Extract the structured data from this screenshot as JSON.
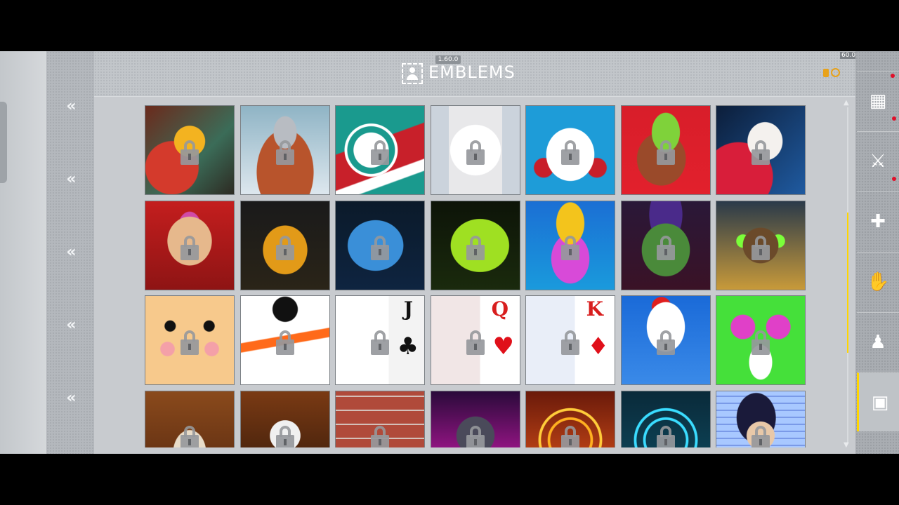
{
  "header": {
    "version": "1.60.0",
    "title": "EMBLEMS",
    "fps": "60.0",
    "title_icon": "profile-frame-icon",
    "currency_icon": "gold-coin-icon"
  },
  "left_rail": {
    "chevrons": [
      "«",
      "«",
      "«",
      "«",
      "«"
    ]
  },
  "right_rail": {
    "buttons": [
      {
        "name": "inventory-crate-icon",
        "glyph": "▦",
        "alert": false
      },
      {
        "name": "weapon-skin-icon",
        "glyph": "⚔",
        "alert": true
      },
      {
        "name": "gun-icon",
        "glyph": "✚",
        "alert": true
      },
      {
        "name": "gloves-icon",
        "glyph": "✋",
        "alert": false
      },
      {
        "name": "character-icon",
        "glyph": "♟",
        "alert": false
      },
      {
        "name": "emblem-profile-icon",
        "glyph": "▣",
        "alert": false,
        "active": true
      }
    ]
  },
  "emblems": {
    "rows": [
      [
        {
          "id": "snake-treasure-jar",
          "locked": true
        },
        {
          "id": "viking-warrior",
          "locked": true
        },
        {
          "id": "high-top-sneaker",
          "locked": true
        },
        {
          "id": "kabuki-mask",
          "locked": true
        },
        {
          "id": "kitsune-fox-mask",
          "locked": true
        },
        {
          "id": "bandana-platypus",
          "locked": true
        },
        {
          "id": "geisha-fan",
          "locked": true
        }
      ],
      [
        {
          "id": "cool-llama",
          "locked": true
        },
        {
          "id": "thinking-gorilla",
          "locked": true
        },
        {
          "id": "blue-ape",
          "locked": true
        },
        {
          "id": "green-zombie-hand",
          "locked": true
        },
        {
          "id": "crowned-skull",
          "locked": true
        },
        {
          "id": "frankenstein",
          "locked": true
        },
        {
          "id": "pharaoh",
          "locked": true
        }
      ],
      [
        {
          "id": "cute-blob",
          "locked": true
        },
        {
          "id": "snowman-face",
          "locked": true
        },
        {
          "id": "jack-of-clubs",
          "locked": true,
          "card_letter": "J",
          "card_suit": "♣"
        },
        {
          "id": "queen-of-hearts",
          "locked": true,
          "card_letter": "Q",
          "card_suit": "♥"
        },
        {
          "id": "king-of-diamonds",
          "locked": true,
          "card_letter": "K",
          "card_suit": "♦"
        },
        {
          "id": "rooster",
          "locked": true
        },
        {
          "id": "hypno-monster",
          "locked": true
        }
      ],
      [
        {
          "id": "hooded-figure",
          "locked": true
        },
        {
          "id": "helmet-soldier",
          "locked": true
        },
        {
          "id": "brick-wall-face",
          "locked": true
        },
        {
          "id": "neon-warrior",
          "locked": true
        },
        {
          "id": "fire-rune-circle",
          "locked": true
        },
        {
          "id": "cyan-magic-circle",
          "locked": true
        },
        {
          "id": "sunglasses-guy",
          "locked": true
        }
      ]
    ]
  },
  "colors": {
    "accent": "#ffd600",
    "alert": "#e0102a"
  }
}
